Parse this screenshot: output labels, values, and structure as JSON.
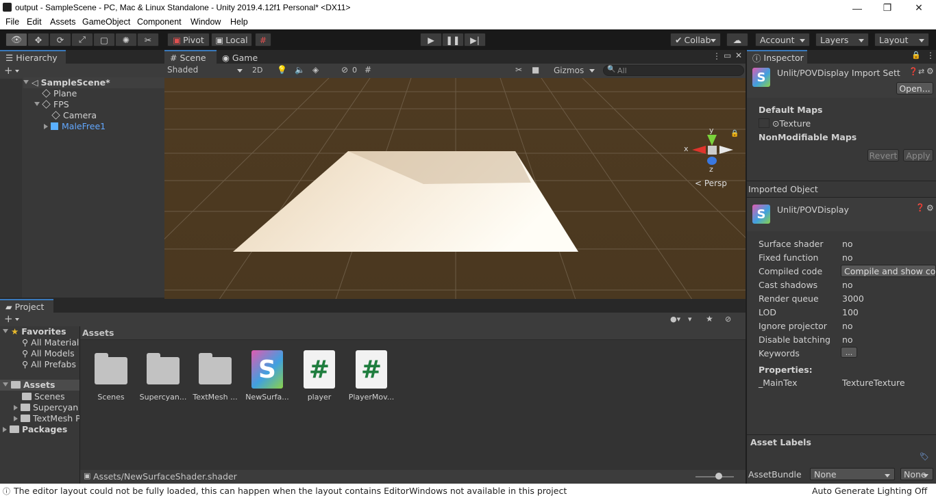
{
  "window": {
    "title": "output - SampleScene - PC, Mac & Linux Standalone - Unity 2019.4.12f1 Personal* <DX11>",
    "min": "—",
    "max": "❐",
    "close": "✕"
  },
  "menu": [
    "File",
    "Edit",
    "Assets",
    "GameObject",
    "Component",
    "Window",
    "Help"
  ],
  "toolbar": {
    "pivot": "Pivot",
    "local": "Local",
    "collab": "Collab",
    "account": "Account",
    "layers": "Layers",
    "layout": "Layout"
  },
  "hierarchy": {
    "tab": "Hierarchy",
    "add": "+",
    "scene": "SampleScene*",
    "items": [
      "Plane",
      "FPS",
      "Camera",
      "MaleFree1"
    ]
  },
  "scene": {
    "tab_scene": "Scene",
    "tab_game": "Game",
    "shading": "Shaded",
    "mode2d": "2D",
    "hidden_count": "0",
    "gizmos": "Gizmos",
    "search_placeholder": "All",
    "axis_x": "x",
    "axis_y": "y",
    "axis_z": "z",
    "persp": "Persp"
  },
  "project": {
    "tab": "Project",
    "favorites": "Favorites",
    "fav_items": [
      "All Materials",
      "All Models",
      "All Prefabs"
    ],
    "assets_root": "Assets",
    "asset_folders": [
      "Scenes",
      "Supercyan Character Pack Free Sample",
      "TextMesh Pro"
    ],
    "packages": "Packages",
    "breadcrumb": "Assets",
    "assets": [
      {
        "name": "Scenes",
        "kind": "folder"
      },
      {
        "name": "Supercyan...",
        "kind": "folder"
      },
      {
        "name": "TextMesh ...",
        "kind": "folder"
      },
      {
        "name": "NewSurfa...",
        "kind": "shader"
      },
      {
        "name": "player",
        "kind": "script"
      },
      {
        "name": "PlayerMov...",
        "kind": "script"
      }
    ],
    "selected_path": "Assets/NewSurfaceShader.shader",
    "zoom_fraction": 0.6
  },
  "inspector": {
    "tab": "Inspector",
    "import_title": "Unlit/POVDisplay Import Sett",
    "open_btn": "Open...",
    "default_maps": "Default Maps",
    "texture_label": "Texture",
    "nonmod_maps": "NonModifiable Maps",
    "revert": "Revert",
    "apply": "Apply",
    "imported_object": "Imported Object",
    "shader_name": "Unlit/POVDisplay",
    "props": [
      {
        "label": "Surface shader",
        "value": "no"
      },
      {
        "label": "Fixed function",
        "value": "no"
      },
      {
        "label": "Compiled code",
        "value": "Compile and show code"
      },
      {
        "label": "Cast shadows",
        "value": "no"
      },
      {
        "label": "Render queue",
        "value": "3000"
      },
      {
        "label": "LOD",
        "value": "100"
      },
      {
        "label": "Ignore projector",
        "value": "no"
      },
      {
        "label": "Disable batching",
        "value": "no"
      },
      {
        "label": "Keywords",
        "value": "..."
      }
    ],
    "properties_header": "Properties:",
    "maintex_label": "_MainTex",
    "maintex_value": "TextureTexture",
    "asset_labels": "Asset Labels",
    "assetbundle_label": "AssetBundle",
    "assetbundle_value": "None",
    "assetbundle_variant": "None"
  },
  "status": {
    "message": "The editor layout could not be fully loaded, this can happen when the layout contains EditorWindows not available in this project",
    "lighting": "Auto Generate Lighting Off"
  }
}
